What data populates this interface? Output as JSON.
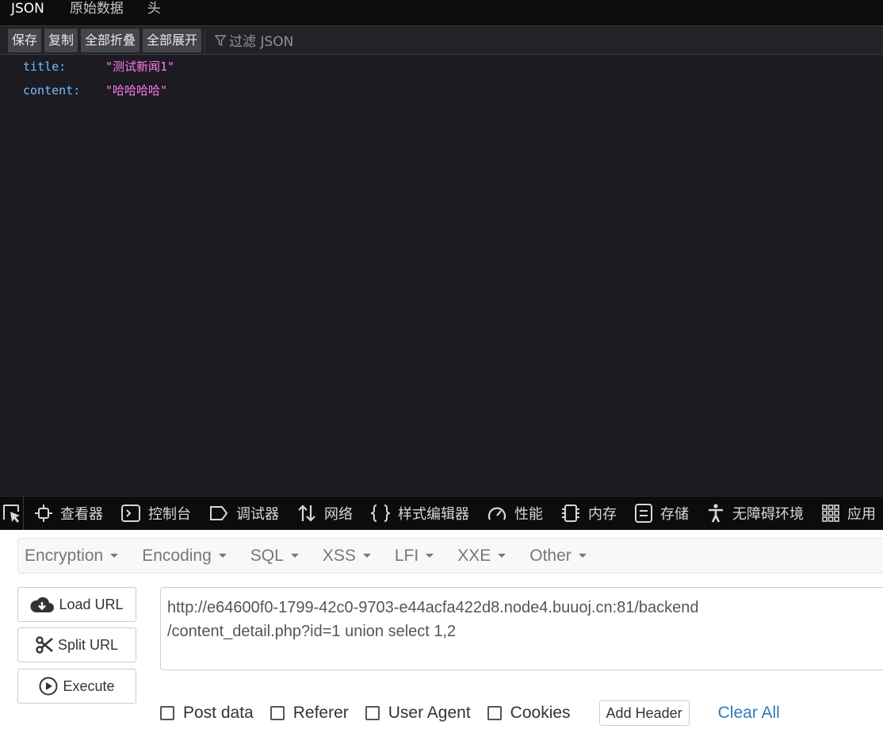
{
  "viewer_tabs": [
    {
      "label": "JSON"
    },
    {
      "label": "原始数据"
    },
    {
      "label": "头"
    }
  ],
  "toolbar": {
    "save": "保存",
    "copy": "复制",
    "collapse_all": "全部折叠",
    "expand_all": "全部展开",
    "filter_placeholder": "过滤 JSON"
  },
  "json_rows": [
    {
      "key": "title:",
      "value": "\"测试新闻1\""
    },
    {
      "key": "content:",
      "value": "\"哈哈哈哈\""
    }
  ],
  "devtools": {
    "tabs": [
      {
        "label": "查看器",
        "icon": "inspector-icon"
      },
      {
        "label": "控制台",
        "icon": "console-icon"
      },
      {
        "label": "调试器",
        "icon": "debugger-icon"
      },
      {
        "label": "网络",
        "icon": "network-icon"
      },
      {
        "label": "样式编辑器",
        "icon": "style-editor-icon"
      },
      {
        "label": "性能",
        "icon": "performance-icon"
      },
      {
        "label": "内存",
        "icon": "memory-icon"
      },
      {
        "label": "存储",
        "icon": "storage-icon"
      },
      {
        "label": "无障碍环境",
        "icon": "accessibility-icon"
      },
      {
        "label": "应用",
        "icon": "application-icon"
      }
    ]
  },
  "hackbar": {
    "menu": [
      {
        "label": "Encryption"
      },
      {
        "label": "Encoding"
      },
      {
        "label": "SQL"
      },
      {
        "label": "XSS"
      },
      {
        "label": "LFI"
      },
      {
        "label": "XXE"
      },
      {
        "label": "Other"
      }
    ],
    "load_url": "Load URL",
    "split_url": "Split URL",
    "execute": "Execute",
    "url_line1": "http://e64600f0-1799-42c0-9703-e44acfa422d8.node4.buuoj.cn:81/backend",
    "url_line2": "/content_detail.php?id=1 union select 1,2",
    "options": {
      "post_data": "Post data",
      "referer": "Referer",
      "user_agent": "User Agent",
      "cookies": "Cookies"
    },
    "add_header": "Add Header",
    "clear_all": "Clear All"
  },
  "colors": {
    "json_key": "#75bfff",
    "json_string": "#ff7de9",
    "link": "#337ab7"
  }
}
